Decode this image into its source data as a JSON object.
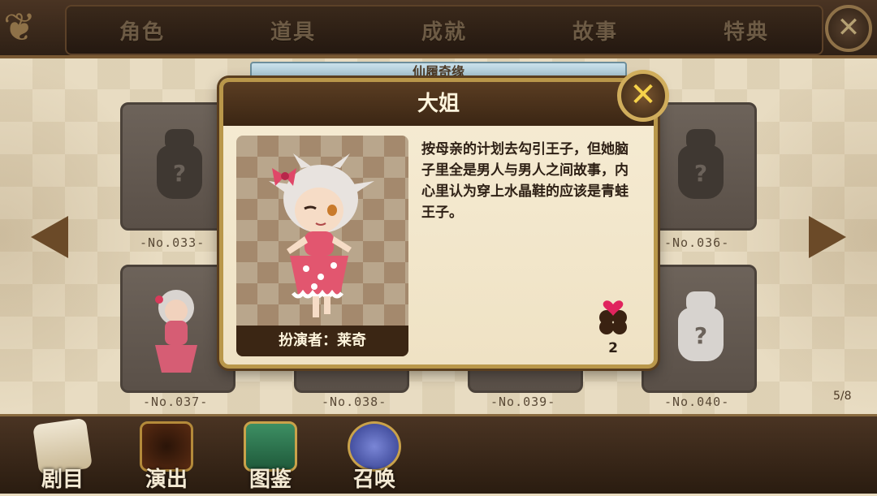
{
  "tabs": [
    "角色",
    "道具",
    "成就",
    "故事",
    "特典"
  ],
  "top_close_label": "✕",
  "subtitle": "仙履奇缘",
  "cards": {
    "top_row": [
      "-No.033-",
      "-No.036-"
    ],
    "bottom_row": [
      "-No.037-",
      "-No.038-",
      "-No.039-",
      "-No.040-"
    ]
  },
  "page_indicator": "5/8",
  "modal": {
    "title": "大姐",
    "close_label": "✕",
    "description": "按母亲的计划去勾引王子，但她脑子里全是男人与男人之间故事，内心里认为穿上水晶鞋的应该是青蛙王子。",
    "actor": "扮演者：莱奇",
    "clover_count": "2"
  },
  "bottom_nav": [
    "剧目",
    "演出",
    "图鉴",
    "召唤"
  ],
  "colors": {
    "accent_gold": "#d0ad5c",
    "header_brown": "#3b2614",
    "clover_heart": "#e0245e"
  }
}
